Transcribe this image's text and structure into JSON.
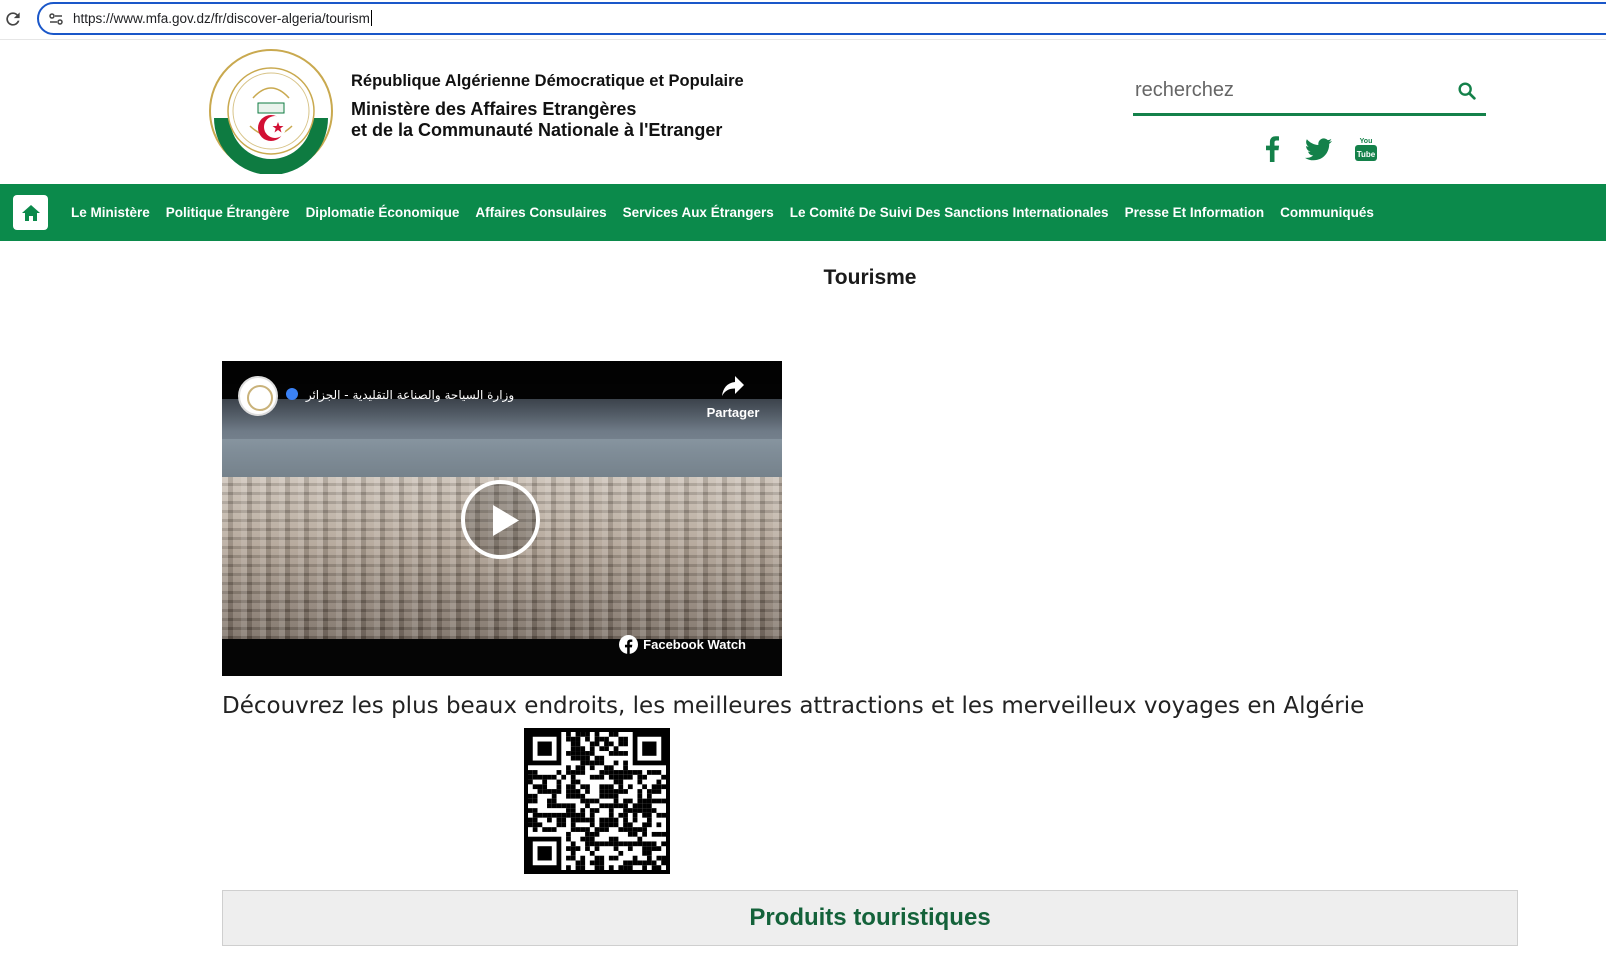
{
  "browser": {
    "url": "https://www.mfa.gov.dz/fr/discover-algeria/tourism"
  },
  "header": {
    "logo_name": "ministry-seal",
    "line1": "République Algérienne Démocratique et Populaire",
    "line2": "Ministère des Affaires Etrangères",
    "line3": "et de la Communauté Nationale à l'Etranger",
    "search_placeholder": "recherchez",
    "socials": [
      "facebook-icon",
      "twitter-icon",
      "youtube-icon"
    ]
  },
  "nav": {
    "items": [
      "Le Ministère",
      "Politique Étrangère",
      "Diplomatie Économique",
      "Affaires Consulaires",
      "Services Aux Étrangers",
      "Le Comité De Suivi Des Sanctions Internationales",
      "Presse Et Information",
      "Communiqués"
    ]
  },
  "main": {
    "title": "Tourisme",
    "video": {
      "channel_name": "وزارة السياحة والصناعة التقليدية - الجزائر",
      "share_label": "Partager",
      "watch_label": "Facebook Watch"
    },
    "intro_text": "Découvrez les plus beaux endroits, les meilleures attractions et les merveilleux voyages en Algérie",
    "products_label": "Produits touristiques"
  },
  "colors": {
    "brand_green": "#0b8a4b",
    "heading_green": "#14623a",
    "omnibox_border": "#1a57c9"
  }
}
